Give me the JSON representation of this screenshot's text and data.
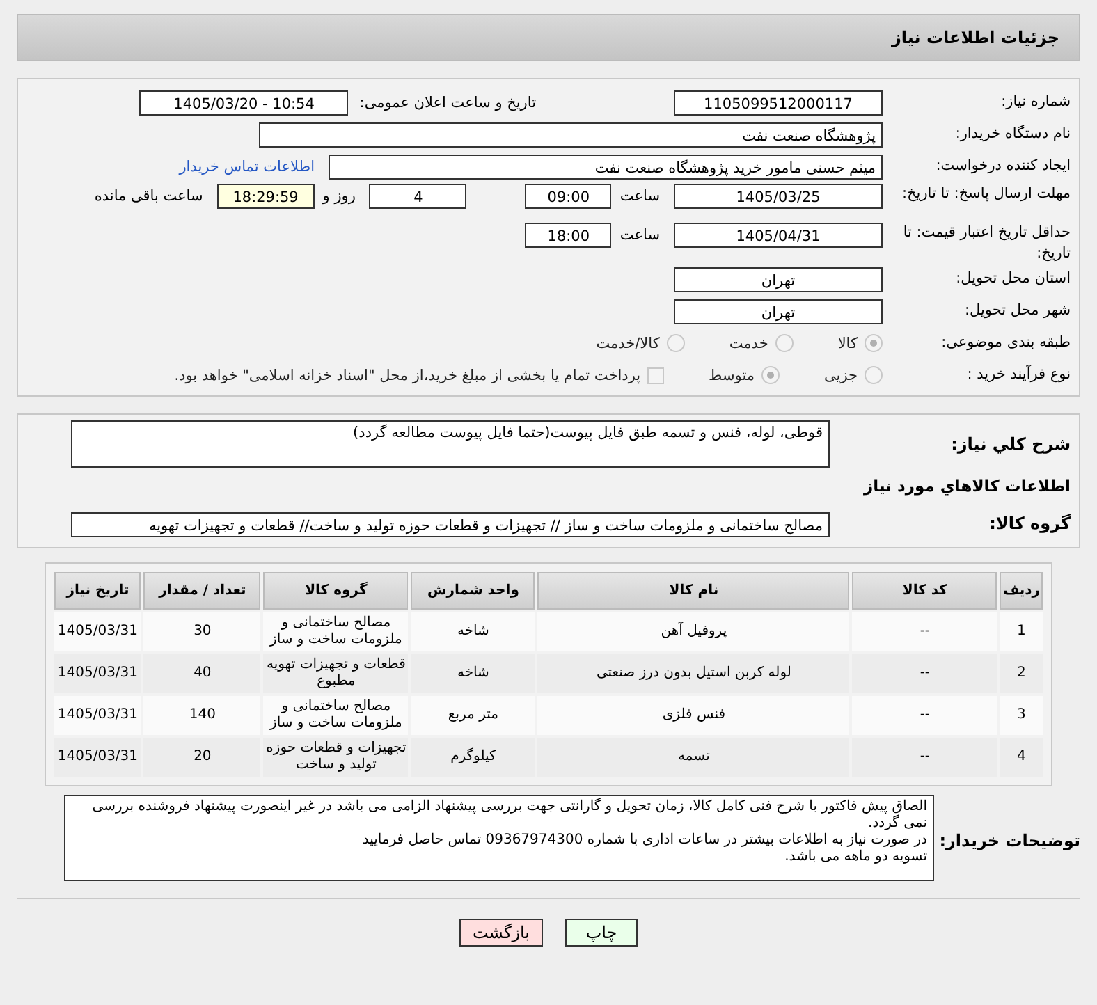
{
  "title": "جزئیات اطلاعات نیاز",
  "need_number": {
    "label": "شماره نیاز:",
    "value": "1105099512000117"
  },
  "announce": {
    "label": "تاریخ و ساعت اعلان عمومی:",
    "value": "1405/03/20 - 10:54"
  },
  "buyer_org": {
    "label": "نام دستگاه خریدار:",
    "value": "پژوهشگاه صنعت نفت"
  },
  "requester": {
    "label": "ایجاد کننده درخواست:",
    "value": "میثم حسنی مامور خرید پژوهشگاه صنعت نفت",
    "link": "اطلاعات تماس خریدار"
  },
  "deadline": {
    "label": "مهلت ارسال پاسخ: تا تاریخ:",
    "date": "1405/03/25",
    "time_label": "ساعت",
    "time": "09:00",
    "days": "4",
    "days_label": "روز و",
    "remaining": "18:29:59",
    "remaining_label": "ساعت باقی مانده"
  },
  "validity": {
    "label": "حداقل تاریخ اعتبار قیمت: تا تاریخ:",
    "date": "1405/04/31",
    "time_label": "ساعت",
    "time": "18:00"
  },
  "province": {
    "label": "استان محل تحویل:",
    "value": "تهران"
  },
  "city": {
    "label": "شهر محل تحویل:",
    "value": "تهران"
  },
  "category": {
    "label": "طبقه بندی موضوعی:",
    "options": [
      {
        "label": "کالا",
        "selected": true
      },
      {
        "label": "خدمت",
        "selected": false
      },
      {
        "label": "کالا/خدمت",
        "selected": false
      }
    ]
  },
  "process": {
    "label": "نوع فرآیند خرید :",
    "options": [
      {
        "label": "جزیی",
        "selected": false
      },
      {
        "label": "متوسط",
        "selected": true
      }
    ],
    "payment": {
      "label": "پرداخت تمام یا بخشی از مبلغ خرید،از محل \"اسناد خزانه اسلامی\" خواهد بود.",
      "checked": false
    }
  },
  "description": {
    "label": "شرح کلي نياز:",
    "value": "قوطی، لوله، فنس و تسمه طبق فایل پیوست(حتما فایل پیوست مطالعه گردد)"
  },
  "goods_heading": "اطلاعات كالاهاي مورد نياز",
  "goods_group": {
    "label": "گروه کالا:",
    "value": "مصالح ساختمانی و ملزومات ساخت و ساز // تجهیزات و قطعات حوزه تولید و ساخت//  قطعات و تجهیزات تهویه"
  },
  "table": {
    "columns": [
      "ردیف",
      "کد کالا",
      "نام کالا",
      "واحد شمارش",
      "گروه کالا",
      "تعداد / مقدار",
      "تاریخ نیاز"
    ],
    "rows": [
      [
        "1",
        "--",
        "پروفیل آهن",
        "شاخه",
        "مصالح ساختمانی و ملزومات ساخت و ساز",
        "30",
        "1405/03/31"
      ],
      [
        "2",
        "--",
        "لوله کربن استیل بدون درز صنعتی",
        "شاخه",
        "قطعات و تجهیزات تهویه مطبوع",
        "40",
        "1405/03/31"
      ],
      [
        "3",
        "--",
        "فنس فلزی",
        "متر مربع",
        "مصالح ساختمانی و ملزومات ساخت و ساز",
        "140",
        "1405/03/31"
      ],
      [
        "4",
        "--",
        "تسمه",
        "کیلوگرم",
        "تجهیزات و قطعات حوزه تولید و ساخت",
        "20",
        "1405/03/31"
      ]
    ]
  },
  "notes": {
    "label": "توضیحات خریدار:",
    "lines": [
      "الصاق پیش فاکتور با شرح فنی کامل کالا، زمان تحویل و گارانتی جهت بررسی پیشنهاد الزامی می باشد در غیر اینصورت پیشنهاد فروشنده بررسی نمی گردد.",
      "در صورت نیاز به اطلاعات بیشتر در ساعات اداری با شماره 09367974300 تماس حاصل فرمایید",
      "تسویه دو ماهه می باشد."
    ]
  },
  "buttons": [
    {
      "kind": "print",
      "label": "چاپ"
    },
    {
      "kind": "back",
      "label": "بازگشت"
    }
  ]
}
